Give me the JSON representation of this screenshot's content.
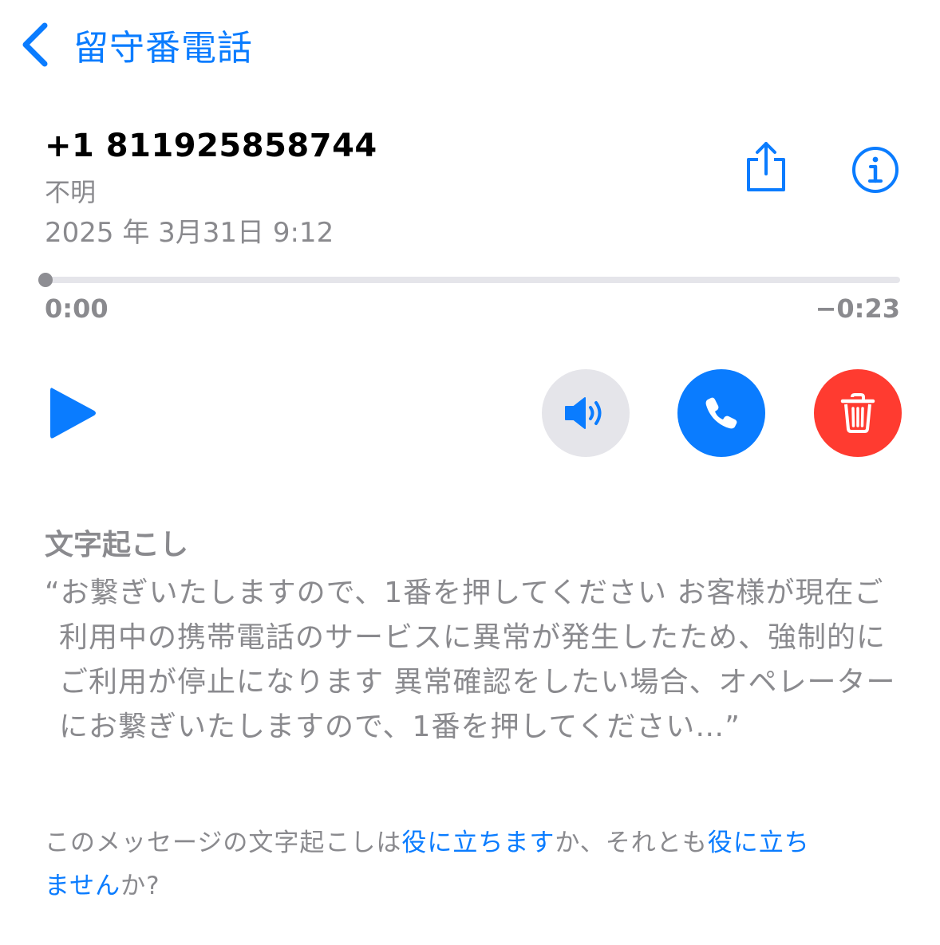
{
  "colors": {
    "accent": "#0a7cff",
    "secondary_text": "#8a8a8e",
    "destructive": "#ff3b30",
    "speaker_bg": "#e5e5ea"
  },
  "nav": {
    "back_label": "留守番電話",
    "back_icon": "chevron-left-icon"
  },
  "voicemail": {
    "number": "+1 811925858744",
    "label": "不明",
    "date": "2025 年 3月31日 9:12",
    "share_icon": "share-icon",
    "info_icon": "info-icon"
  },
  "player": {
    "elapsed": "0:00",
    "remaining": "−0:23",
    "progress": 0.0,
    "play_icon": "play-icon",
    "speaker_icon": "speaker-icon",
    "call_icon": "phone-icon",
    "delete_icon": "trash-icon"
  },
  "transcript": {
    "heading": "文字起こし",
    "text": "“お繋ぎいたしますので、1番を押してください お客様が現在ご利用中の携帯電話のサービスに異常が発生したため、強制的にご利用が停止になります 異常確認をしたい場合、オペレーターにお繋ぎいたしますので、1番を押してください…”"
  },
  "feedback": {
    "prefix": "このメッセージの文字起こしは",
    "useful_link": "役に立ちます",
    "middle": "か、それとも",
    "not_useful_link": "役に立ちません",
    "suffix": "か?"
  }
}
